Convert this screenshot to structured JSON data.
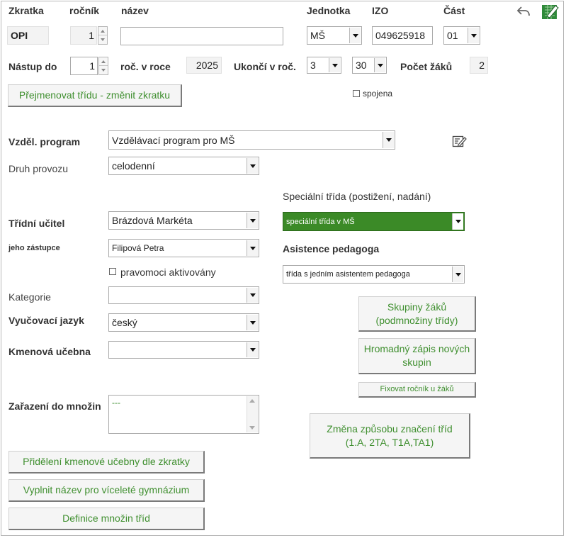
{
  "header": {
    "col_zkratka": "Zkratka",
    "col_rocnik": "ročník",
    "col_nazev": "název",
    "col_jednotka": "Jednotka",
    "col_izo": "IZO",
    "col_cast": "Část"
  },
  "row1": {
    "zkratka": "OPI",
    "rocnik": "1",
    "nazev": "",
    "jednotka": "MŠ",
    "izo": "049625918",
    "cast": "01"
  },
  "row2": {
    "nastup_label": "Nástup do",
    "nastup_value": "1",
    "roc_v_roce_label": "roč. v roce",
    "roc_v_roce_value": "2025",
    "ukonci_label": "Ukončí v roč.",
    "ukonci_value": "3",
    "ukonci_value2": "30",
    "pocet_zaku_label": "Počet žáků",
    "pocet_zaku_value": "2"
  },
  "rename_button": "Přejmenovat třídu - změnit zkratku",
  "spojena_label": "spojena",
  "program": {
    "label": "Vzděl. program",
    "value": "Vzdělávací program pro MŠ"
  },
  "provoz": {
    "label": "Druh provozu",
    "value": "celodenní"
  },
  "special": {
    "label": "Speciální třída (postižení, nadání)",
    "value": "speciální třída v MŠ"
  },
  "ucitel": {
    "label": "Třídní učitel",
    "value": "Brázdová Markéta"
  },
  "zastupce": {
    "label": "jeho zástupce",
    "value": "Filipová Petra"
  },
  "asistence": {
    "label": "Asistence pedagoga",
    "value": "třída s jedním asistentem pedagoga"
  },
  "pravomoci_label": "pravomoci aktivovány",
  "kategorie": {
    "label": "Kategorie",
    "value": ""
  },
  "jazyk": {
    "label": "Vyučovací jazyk",
    "value": "český"
  },
  "ucebna": {
    "label": "Kmenová učebna",
    "value": ""
  },
  "mnoziny": {
    "label": "Zařazení do množin",
    "value": "---"
  },
  "buttons": {
    "skupiny_line1": "Skupiny žáků",
    "skupiny_line2": "(podmnožiny třídy)",
    "hromadny_line1": "Hromadný zápis nových",
    "hromadny_line2": "skupin",
    "fixovat": "Fixovat ročník u žáků",
    "zmena_line1": "Změna způsobu značení tříd",
    "zmena_line2": "(1.A, 2TA, T1A,TA1)",
    "prideleni": "Přidělení kmenové učebny dle zkratky",
    "vyplnit": "Vyplnit název pro víceleté gymnázium",
    "definice": "Definice množin tříd"
  },
  "colors": {
    "accent_green": "#3b8a27",
    "button_text": "#3f8f2f"
  },
  "icons": [
    "undo-icon",
    "edit-sheet-icon",
    "edit-note-icon"
  ]
}
